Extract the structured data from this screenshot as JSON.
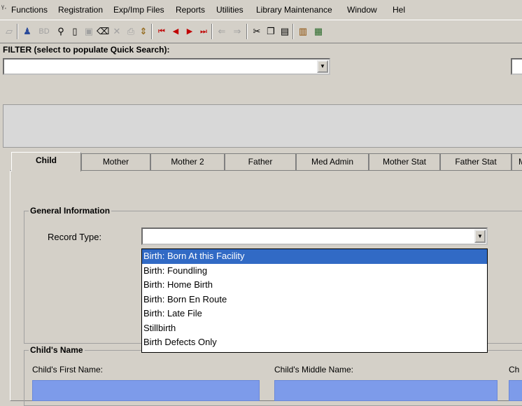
{
  "menubar": {
    "items": [
      {
        "label": "Functions"
      },
      {
        "label": "Registration"
      },
      {
        "label": "Exp/Imp Files"
      },
      {
        "label": "Reports"
      },
      {
        "label": "Utilities"
      },
      {
        "label": "Library Maintenance"
      },
      {
        "label": "Window"
      },
      {
        "label": "Hel"
      }
    ]
  },
  "toolbar": {
    "bd_label": "BD"
  },
  "filter": {
    "label": "FILTER (select to populate Quick Search):",
    "value": ""
  },
  "tabs": [
    {
      "label": "Child",
      "active": true
    },
    {
      "label": "Mother"
    },
    {
      "label": "Mother 2"
    },
    {
      "label": "Father"
    },
    {
      "label": "Med Admin"
    },
    {
      "label": "Mother Stat"
    },
    {
      "label": "Father Stat"
    },
    {
      "label": "M"
    }
  ],
  "general_info": {
    "title": "General Information",
    "record_type_label": "Record Type:",
    "record_type_value": ""
  },
  "record_type_options": [
    {
      "label": "Birth:  Born At this Facility",
      "selected": true
    },
    {
      "label": "Birth:  Foundling"
    },
    {
      "label": "Birth:  Home Birth"
    },
    {
      "label": "Birth:  Born En Route"
    },
    {
      "label": "Birth:  Late File"
    },
    {
      "label": "Stillbirth"
    },
    {
      "label": "Birth Defects Only"
    }
  ],
  "childs_name": {
    "title": "Child's Name",
    "first_name_label": "Child's First Name:",
    "middle_name_label": "Child's Middle Name:",
    "last_name_label": "Ch"
  },
  "colors": {
    "selection": "#316ac5",
    "required_field": "#7d9bea",
    "chrome": "#d4d0c8"
  }
}
